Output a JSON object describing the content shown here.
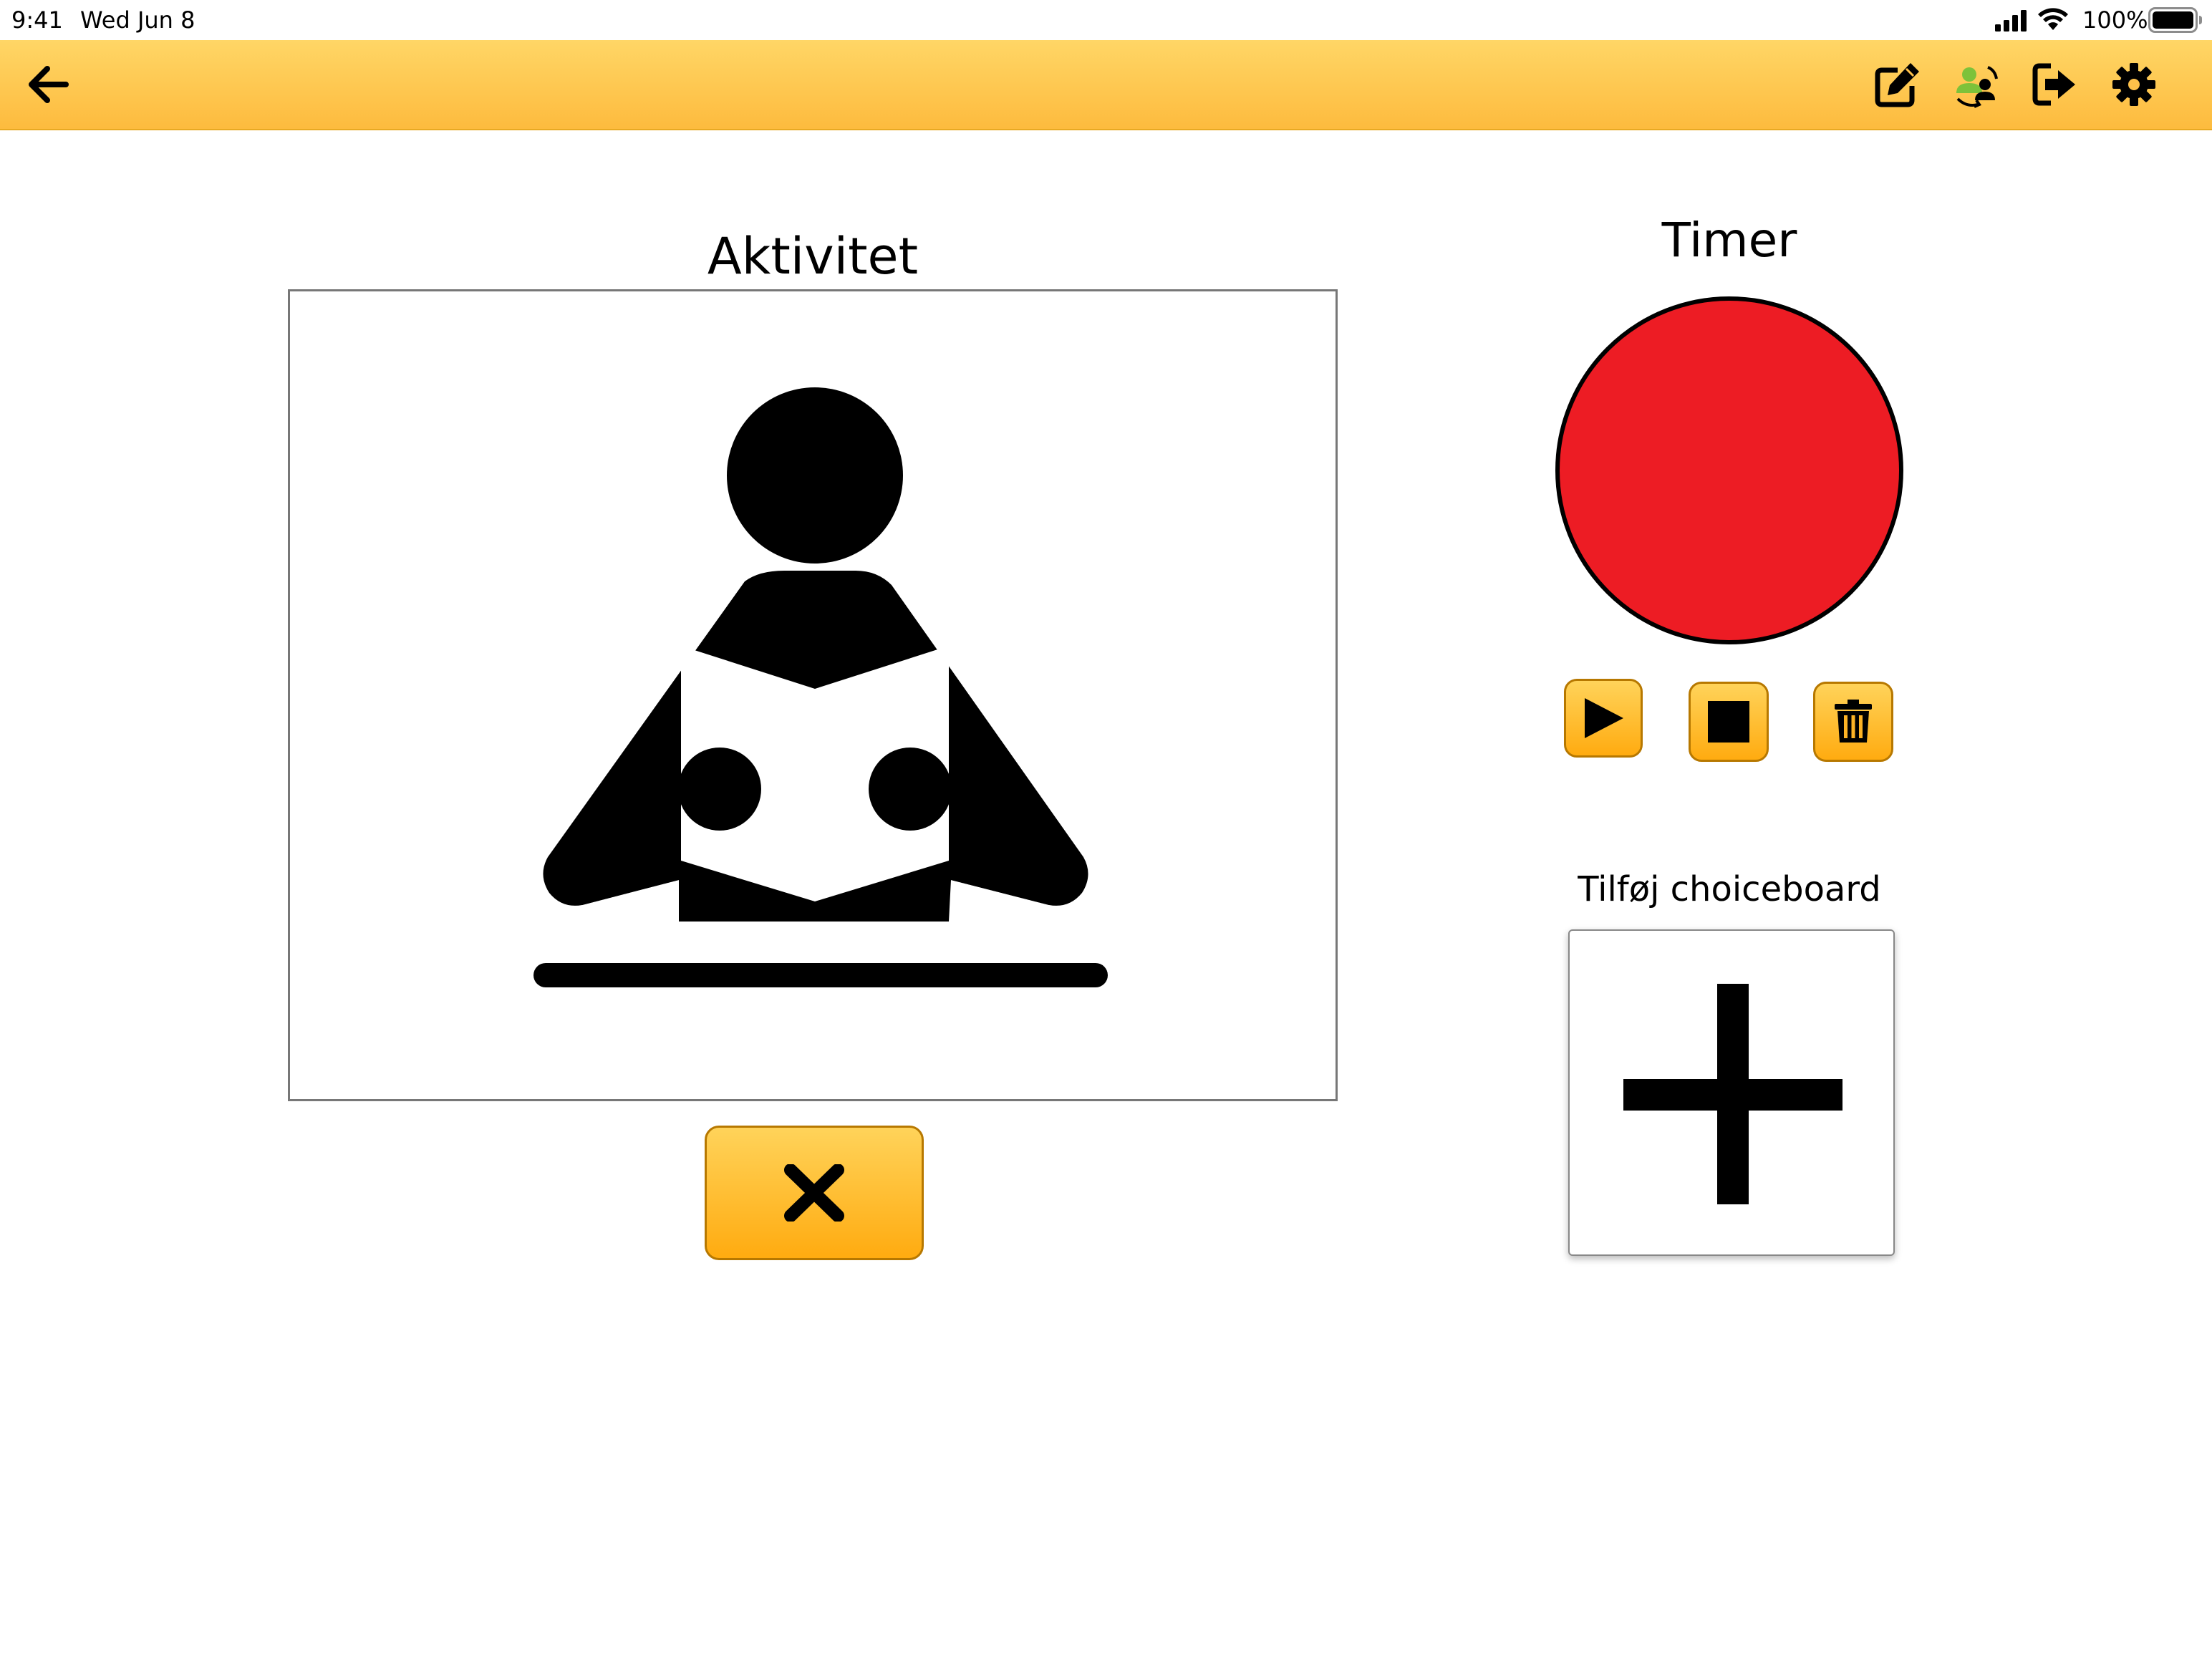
{
  "status_bar": {
    "time": "9:41",
    "date": "Wed Jun 8",
    "battery_percent": "100%",
    "icons": [
      "cellular-signal-icon",
      "wifi-icon",
      "battery-icon"
    ]
  },
  "toolbar": {
    "background_color": "#fdc04a",
    "buttons": [
      {
        "name": "back-button",
        "icon": "arrow-left-icon"
      },
      {
        "name": "edit-button",
        "icon": "edit-icon"
      },
      {
        "name": "switch-user-button",
        "icon": "user-switch-icon"
      },
      {
        "name": "logout-button",
        "icon": "logout-icon"
      },
      {
        "name": "settings-button",
        "icon": "gear-icon"
      }
    ]
  },
  "activity": {
    "heading": "Aktivitet",
    "pictogram": "person-reading-icon",
    "remove_button_icon": "close-icon"
  },
  "timer": {
    "heading": "Timer",
    "color": "#ed1c24",
    "controls": [
      {
        "name": "timer-play-button",
        "icon": "play-icon"
      },
      {
        "name": "timer-stop-button",
        "icon": "stop-icon"
      },
      {
        "name": "timer-delete-button",
        "icon": "trash-icon"
      }
    ]
  },
  "choiceboard": {
    "heading": "Tilføj choiceboard",
    "add_icon": "plus-icon"
  }
}
